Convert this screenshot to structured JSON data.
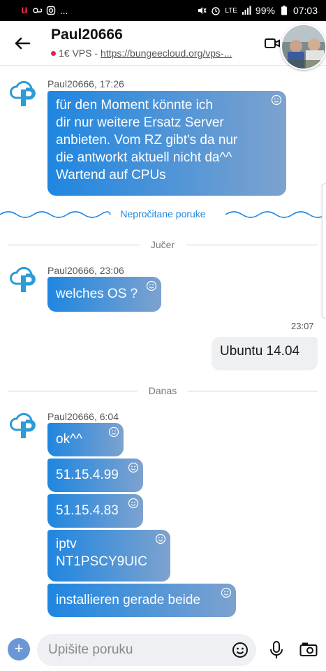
{
  "status_bar": {
    "app_letter": "u",
    "more": "...",
    "network": "LTE",
    "battery": "99%",
    "time": "07:03"
  },
  "header": {
    "title": "Paul20666",
    "subtitle_prefix": "1€ VPS - ",
    "subtitle_link": "https://bungeecloud.org/vps-..."
  },
  "messages": {
    "m1": {
      "sender": "Paul20666, 17:26",
      "lines": [
        "für den Moment könnte ich",
        "dir nur weitere Ersatz Server",
        "anbieten. Vom RZ gibt's da nur",
        "die antworkt aktuell nicht da^^",
        "Wartend auf CPUs"
      ]
    },
    "unread_label": "Nepročitane poruke",
    "divider_yesterday": "Jučer",
    "m2": {
      "sender": "Paul20666, 23:06",
      "text": "welches OS ?"
    },
    "out1": {
      "time": "23:07",
      "text": "Ubuntu 14.04"
    },
    "divider_today": "Danas",
    "m3": {
      "sender": "Paul20666, 6:04"
    },
    "m3a": {
      "text": "ok^^"
    },
    "m3b": {
      "text": "51.15.4.99"
    },
    "m3c": {
      "text": "51.15.4.83"
    },
    "m3d": {
      "lines": [
        "iptv",
        "NT1PSCY9UIC"
      ]
    },
    "m3e": {
      "text": "installieren gerade beide"
    }
  },
  "composer": {
    "placeholder": "Upišite poruku",
    "plus": "+"
  },
  "colors": {
    "bubble_start": "#1f86e0",
    "bubble_end": "#7da2cf",
    "accent": "#1f86e0",
    "unread_dot": "#e0264a"
  }
}
